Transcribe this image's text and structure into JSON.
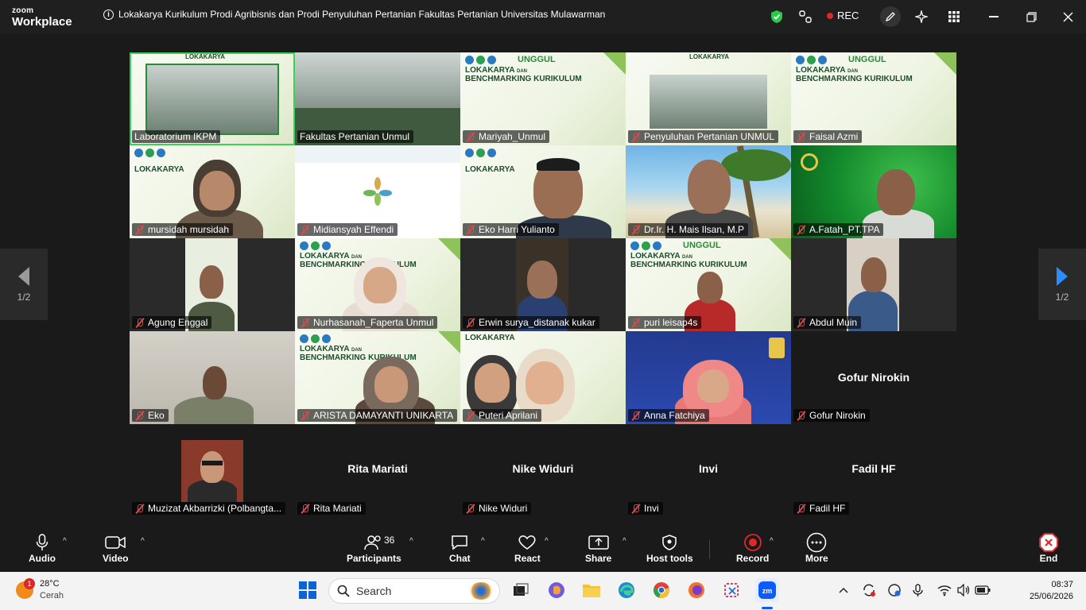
{
  "titlebar": {
    "brand_top": "zoom",
    "brand_bottom": "Workplace",
    "meeting_title": "Lokakarya Kurikulum Prodi Agribisnis dan Prodi Penyuluhan Pertanian Fakultas Pertanian Universitas Mulawarman",
    "rec_label": "REC"
  },
  "pager": {
    "left_label": "1/2",
    "right_label": "1/2"
  },
  "tiles": [
    {
      "name": "Laboratorium IKPM",
      "bg": "room-slide",
      "muted": false
    },
    {
      "name": "Fakultas Pertanian Unmul",
      "bg": "room",
      "muted": false
    },
    {
      "name": "Mariyah_Unmul",
      "bg": "slide",
      "muted": true
    },
    {
      "name": "Penyuluhan Pertanian UNMUL",
      "bg": "room-slide",
      "muted": true
    },
    {
      "name": "Faisal Azmi",
      "bg": "slide",
      "muted": true
    },
    {
      "name": "mursidah mursidah",
      "bg": "slide",
      "muted": true
    },
    {
      "name": "Midiansyah Effendi",
      "bg": "white",
      "muted": true
    },
    {
      "name": "Eko Harri Yulianto",
      "bg": "slide",
      "muted": true
    },
    {
      "name": "Dr.Ir. H. Mais Ilsan, M.P",
      "bg": "beach",
      "muted": true
    },
    {
      "name": "A.Fatah_PT.TPA",
      "bg": "green",
      "muted": true
    },
    {
      "name": "Agung Enggal",
      "bg": "dark",
      "muted": true
    },
    {
      "name": "Nurhasanah_Faperta Unmul",
      "bg": "slide",
      "muted": true
    },
    {
      "name": "Erwin surya_distanak kukar",
      "bg": "dark",
      "muted": true
    },
    {
      "name": "puri leisap4s",
      "bg": "slide",
      "muted": true
    },
    {
      "name": "Abdul Muin",
      "bg": "dark",
      "muted": true
    },
    {
      "name": "Eko",
      "bg": "wall",
      "muted": true
    },
    {
      "name": "ARISTA DAMAYANTI UNIKARTA",
      "bg": "slide",
      "muted": true
    },
    {
      "name": "Puteri Aprilani",
      "bg": "slide",
      "muted": true
    },
    {
      "name": "Anna Fatchiya",
      "bg": "blue",
      "muted": true
    },
    {
      "name": "Gofur Nirokin",
      "bg": "none",
      "muted": true,
      "center_name": "Gofur Nirokin"
    },
    {
      "name": "Muzizat Akbarrizki (Polbangta...",
      "bg": "none",
      "muted": true
    },
    {
      "name": "Rita Mariati",
      "bg": "none",
      "muted": true,
      "center_name": "Rita Mariati"
    },
    {
      "name": "Nike Widuri",
      "bg": "none",
      "muted": true,
      "center_name": "Nike Widuri"
    },
    {
      "name": "Invi",
      "bg": "none",
      "muted": true,
      "center_name": "Invi"
    },
    {
      "name": "Fadil HF",
      "bg": "none",
      "muted": true,
      "center_name": "Fadil HF"
    }
  ],
  "slide_text": {
    "title_line1": "LOKAKARYA",
    "title_small": "DAN",
    "title_line2": "BENCHMARKING KURIKULUM",
    "unggul": "UNGGUL",
    "loka_header": "LOKAKARYA"
  },
  "toolbar": {
    "audio": "Audio",
    "video": "Video",
    "participants": "Participants",
    "participants_count": "36",
    "chat": "Chat",
    "react": "React",
    "share": "Share",
    "host_tools": "Host tools",
    "record": "Record",
    "more": "More",
    "end": "End"
  },
  "taskbar": {
    "weather_badge": "1",
    "temp": "28°C",
    "condition": "Cerah",
    "search_placeholder": "Search",
    "time": "08:37",
    "date": "25/06/2026"
  },
  "colors": {
    "accent_green": "#3cd25a",
    "rec_red": "#e02828",
    "mute_red": "#e64545"
  }
}
